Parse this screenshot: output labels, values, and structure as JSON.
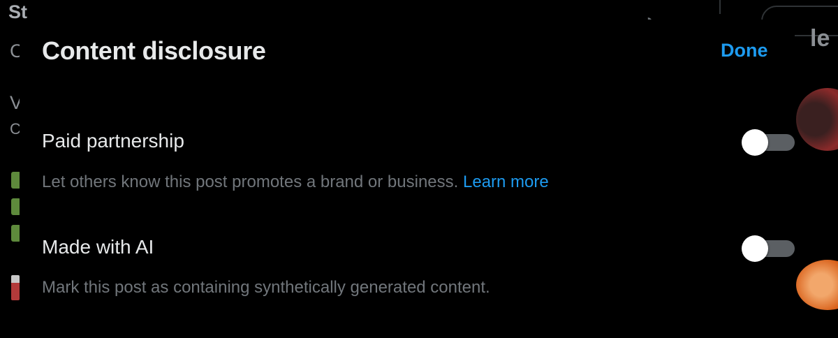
{
  "background": {
    "header_name_fragment": "Strike Official",
    "side_letters": [
      "C",
      "V",
      "C"
    ],
    "right_fragment": "le"
  },
  "modal": {
    "title": "Content disclosure",
    "done_label": "Done",
    "options": [
      {
        "title": "Paid partnership",
        "description": "Let others know this post promotes a brand or business.",
        "link_label": "Learn more",
        "enabled": false
      },
      {
        "title": "Made with AI",
        "description": "Mark this post as containing synthetically generated content.",
        "enabled": false
      }
    ]
  },
  "colors": {
    "accent": "#1d9bf0",
    "background": "#000000",
    "primary_text": "#e7e9ea",
    "secondary_text": "#71767b",
    "toggle_off_track": "#5b5f63"
  }
}
